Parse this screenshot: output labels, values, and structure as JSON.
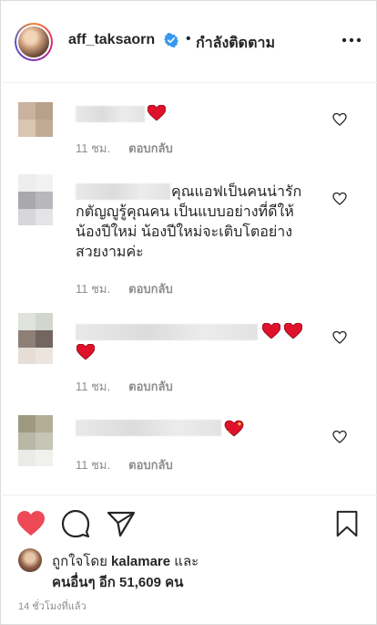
{
  "header": {
    "username": "aff_taksaorn",
    "separator": "•",
    "follow_status": "กำลังติดตาม",
    "more_icon": "more-horizontal-icon",
    "verified_icon": "verified-badge-icon"
  },
  "comments": [
    {
      "text": "",
      "time": "11 ชม.",
      "reply": "ตอบกลับ"
    },
    {
      "text_line1": "คุณแอฟเป็นคนน่ารัก",
      "text_line2": "กตัญญูรู้คุณคน เป็นแบบอย่างที่ดีให้",
      "text_line3": "น้องปีใหม่ น้องปีใหม่จะเติบโตอย่าง",
      "text_line4": "สวยงามค่ะ",
      "time": "11 ชม.",
      "reply": "ตอบกลับ"
    },
    {
      "text": "",
      "time": "11 ชม.",
      "reply": "ตอบกลับ"
    },
    {
      "text": "",
      "time": "11 ชม.",
      "reply": "ตอบกลับ"
    }
  ],
  "actions": {
    "like_icon": "heart-filled-icon",
    "comment_icon": "comment-icon",
    "share_icon": "share-icon",
    "save_icon": "bookmark-icon"
  },
  "likes": {
    "prefix": "ถูกใจโดย ",
    "user": "kalamare",
    "suffix": " และ",
    "others": "คนอื่นๆ อีก 51,609 คน"
  },
  "time_ago": "14 ชั่วโมงที่แล้ว",
  "colors": {
    "like_red": "#ed4956",
    "verified_blue": "#3897f0",
    "meta_gray": "#8e8e8e"
  }
}
